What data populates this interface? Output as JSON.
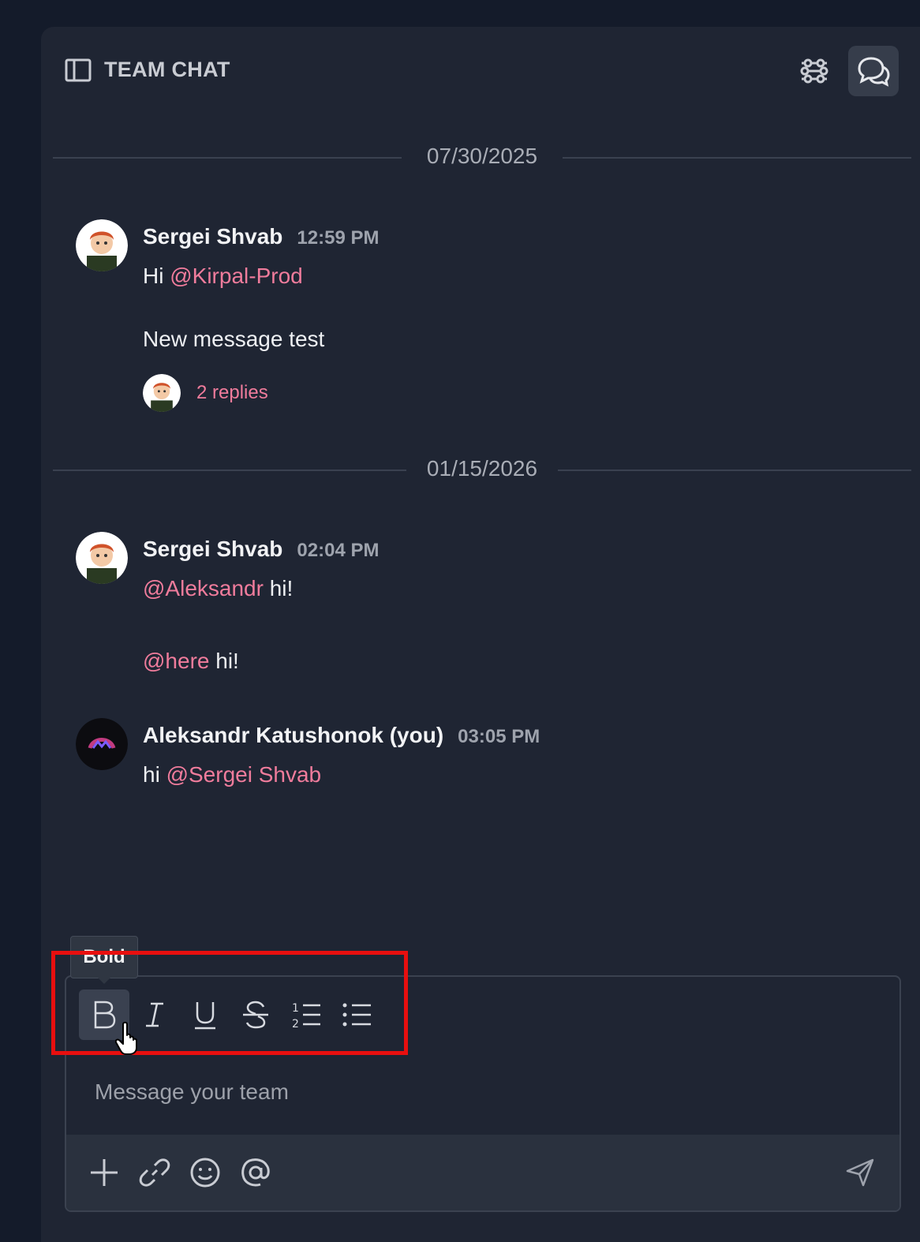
{
  "header": {
    "title": "TEAM CHAT",
    "icons": [
      "sidebar-toggle-icon",
      "filter-icon",
      "chat-bubbles-icon"
    ]
  },
  "dates": [
    "07/30/2025",
    "01/15/2026"
  ],
  "messages": [
    {
      "author": "Sergei Shvab",
      "time": "12:59 PM",
      "line1_prefix": "Hi ",
      "line1_mention": "@Kirpal-Prod",
      "line2": "New message test",
      "replies": "2 replies"
    },
    {
      "author": "Sergei Shvab",
      "time": "02:04 PM",
      "line1_mention": "@Aleksandr",
      "line1_suffix": " hi!",
      "line2_mention": "@here",
      "line2_suffix": " hi!"
    },
    {
      "author": "Aleksandr Katushonok (you)",
      "time": "03:05 PM",
      "line1_prefix": "hi ",
      "line1_mention": "@Sergei Shvab"
    }
  ],
  "composer": {
    "placeholder": "Message your team",
    "tooltip": "Bold",
    "toolbar": [
      "bold",
      "italic",
      "underline",
      "strikethrough",
      "numbered-list",
      "bulleted-list"
    ],
    "actions": [
      "add",
      "link",
      "emoji",
      "mention",
      "send"
    ]
  },
  "colors": {
    "background": "#141b2a",
    "panel": "#1f2533",
    "mention": "#f07c9c",
    "highlight": "#e80f0f"
  }
}
